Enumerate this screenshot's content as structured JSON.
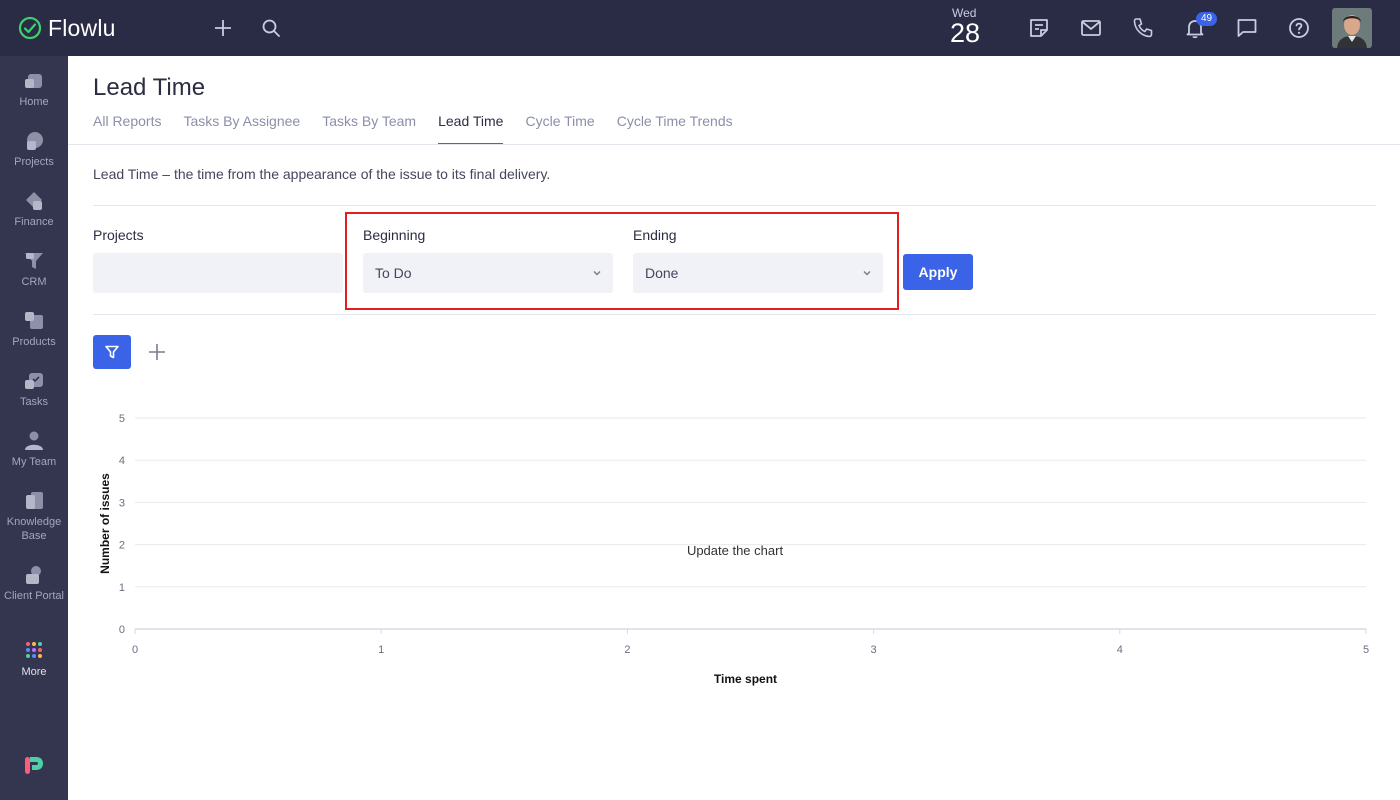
{
  "app": {
    "name": "Flowlu",
    "date_day": "Wed",
    "date_number": "28",
    "notification_count": "49"
  },
  "sidebar": {
    "items": [
      {
        "label": "Home",
        "icon": "home-icon"
      },
      {
        "label": "Projects",
        "icon": "projects-icon"
      },
      {
        "label": "Finance",
        "icon": "finance-icon"
      },
      {
        "label": "CRM",
        "icon": "crm-icon"
      },
      {
        "label": "Products",
        "icon": "products-icon"
      },
      {
        "label": "Tasks",
        "icon": "tasks-icon"
      },
      {
        "label": "My Team",
        "icon": "team-icon"
      },
      {
        "label": "Knowledge Base",
        "icon": "knowledge-base-icon"
      },
      {
        "label": "Client Portal",
        "icon": "client-portal-icon"
      },
      {
        "label": "More",
        "icon": "grid-dots-icon"
      }
    ]
  },
  "page": {
    "title": "Lead Time",
    "description": "Lead Time – the time from the appearance of the issue to its final delivery.",
    "tabs": [
      {
        "label": "All Reports"
      },
      {
        "label": "Tasks By Assignee"
      },
      {
        "label": "Tasks By Team"
      },
      {
        "label": "Lead Time",
        "active": true
      },
      {
        "label": "Cycle Time"
      },
      {
        "label": "Cycle Time Trends"
      }
    ]
  },
  "filters": {
    "projects_label": "Projects",
    "projects_value": "",
    "beginning_label": "Beginning",
    "beginning_value": "To Do",
    "ending_label": "Ending",
    "ending_value": "Done",
    "apply_label": "Apply"
  },
  "colors": {
    "accent": "#3b63e8",
    "topbar": "#2a2b45",
    "sidebar": "#34354f",
    "highlight": "#e02020"
  },
  "chart_data": {
    "type": "scatter",
    "xlabel": "Time spent",
    "ylabel": "Number of issues",
    "xlim": [
      0,
      5
    ],
    "ylim": [
      0,
      5
    ],
    "x_ticks": [
      0,
      1,
      2,
      3,
      4,
      5
    ],
    "y_ticks": [
      0,
      1,
      2,
      3,
      4,
      5
    ],
    "grid": true,
    "series": [],
    "annotation": "Update the chart"
  }
}
